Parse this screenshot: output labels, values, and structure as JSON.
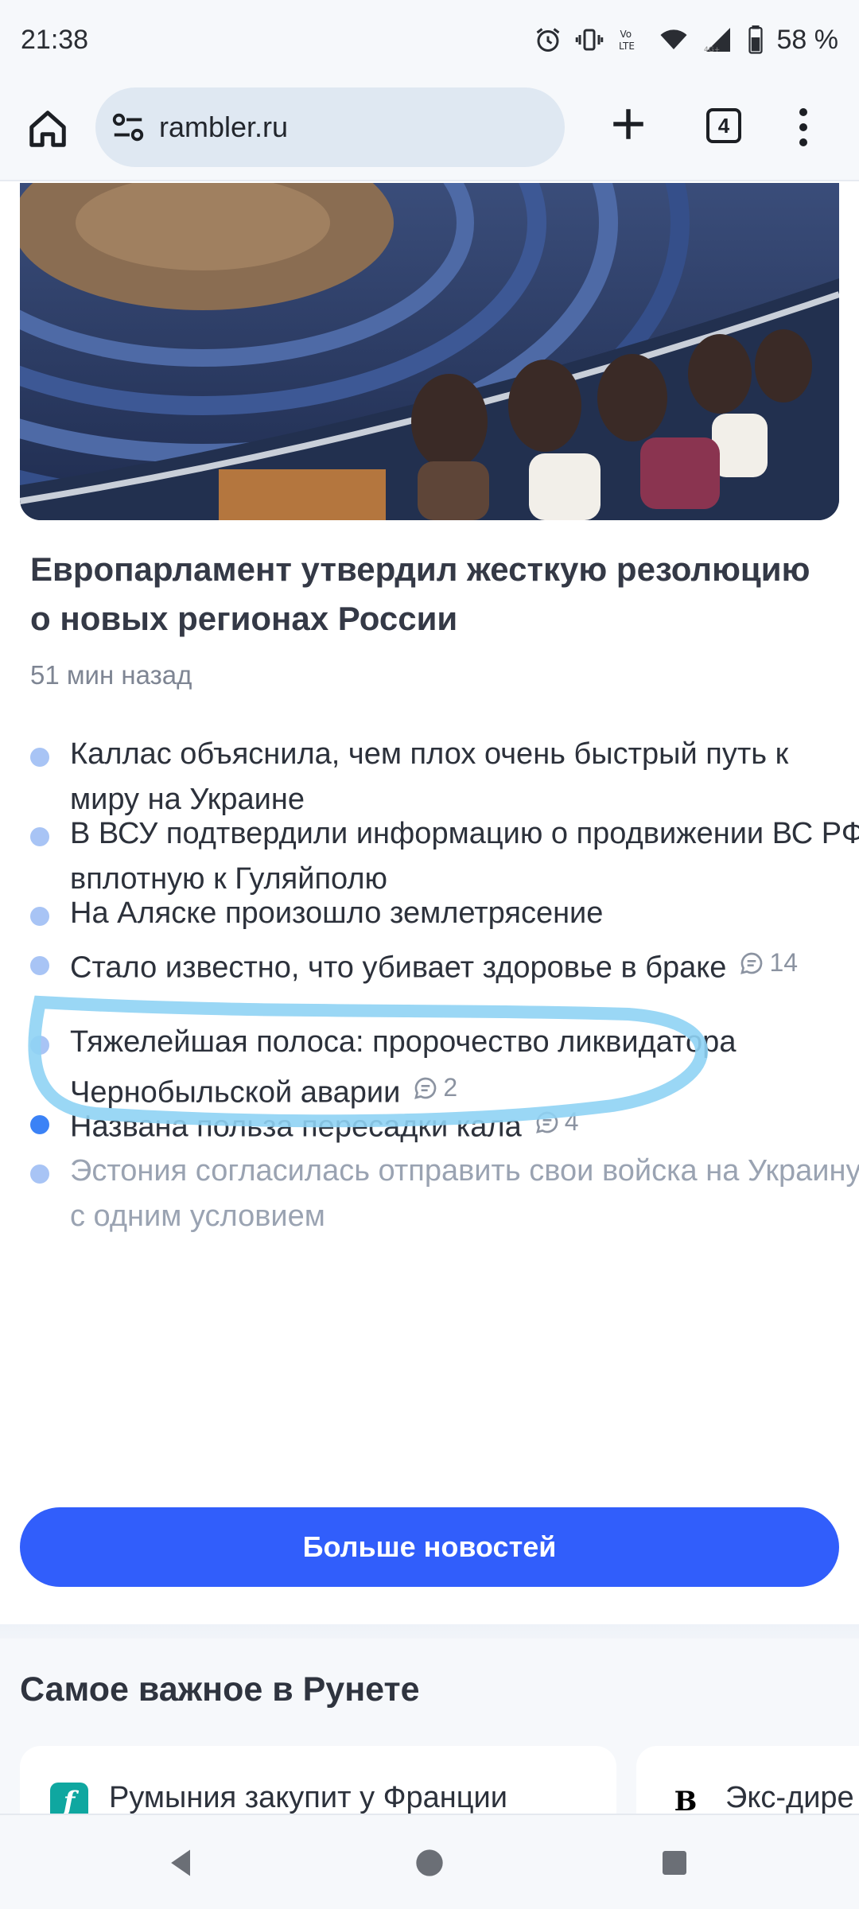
{
  "status_bar": {
    "time": "21:38",
    "battery": "58 %",
    "icons": [
      "alarm-icon",
      "vibrate-icon",
      "volte-icon",
      "wifi-icon",
      "signal-icon",
      "battery-icon"
    ],
    "network_label": "4G+",
    "volte_label": "Vo LTE"
  },
  "browser": {
    "url": "rambler.ru",
    "tab_count": "4"
  },
  "article": {
    "headline": "Европарламент утвердил жесткую резолюцию о новых регионах России",
    "timestamp": "51 мин назад"
  },
  "news": [
    {
      "text": "Каллас объяснила, чем плох очень быстрый путь к миру на Украине",
      "comments": ""
    },
    {
      "text": "В ВСУ подтвердили информацию о продвижении ВС РФ вплотную к Гуляйполю",
      "comments": ""
    },
    {
      "text": "На Аляске произошло землетрясение",
      "comments": ""
    },
    {
      "text": "Стало известно, что убивает здоровье в браке",
      "comments": "14"
    },
    {
      "text": "Тяжелейшая полоса: пророчество ликвидатора Чернобыльской аварии",
      "comments": "2"
    },
    {
      "text": "Названа польза пересадки кала",
      "comments": "4"
    },
    {
      "text": "Эстония согласилась отправить свои войска на Украину с одним условием",
      "comments": ""
    }
  ],
  "more_button": "Больше новостей",
  "section": {
    "title": "Самое важное в Рунете",
    "cards": [
      {
        "logo": "f",
        "text": "Румыния закупит у Франции"
      },
      {
        "logo": "В",
        "text": "Экс-дире"
      }
    ]
  },
  "colors": {
    "accent": "#315efb",
    "bullet": "#a8c4f5",
    "highlight": "#8fd3f4"
  }
}
